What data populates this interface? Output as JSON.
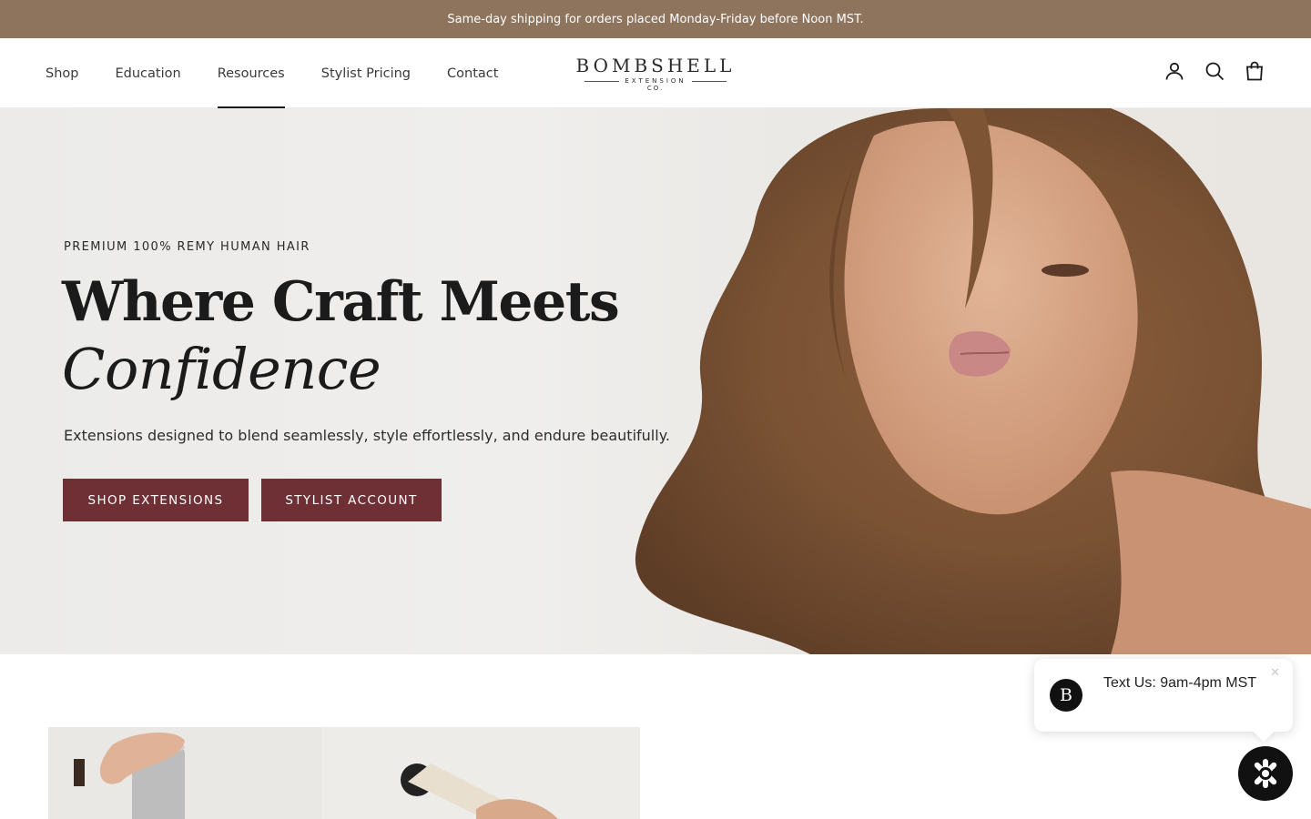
{
  "announcement": {
    "text": "Same-day shipping for orders placed Monday-Friday before Noon MST."
  },
  "nav": {
    "items": [
      {
        "label": "Shop"
      },
      {
        "label": "Education"
      },
      {
        "label": "Resources"
      },
      {
        "label": "Stylist Pricing"
      },
      {
        "label": "Contact"
      }
    ],
    "active": "Resources"
  },
  "logo": {
    "main": "BOMBSHELL",
    "sub": "EXTENSION",
    "co": "CO."
  },
  "header_icons": [
    "account-icon",
    "search-icon",
    "cart-icon"
  ],
  "hero": {
    "eyebrow": "PREMIUM 100% REMY HUMAN HAIR",
    "headline_line1": "Where Craft Meets",
    "headline_line2": "Confidence",
    "subtitle": "Extensions designed to blend seamlessly, style effortlessly, and endure beautifully.",
    "primary_button": "SHOP EXTENSIONS",
    "secondary_button": "STYLIST ACCOUNT"
  },
  "chat": {
    "avatar_letter": "B",
    "message": "Text Us: 9am-4pm MST",
    "close": "✕"
  },
  "colors": {
    "announcement_bg": "#8e735d",
    "button_bg": "#6e2f35",
    "text_dark": "#1b1b1b"
  }
}
